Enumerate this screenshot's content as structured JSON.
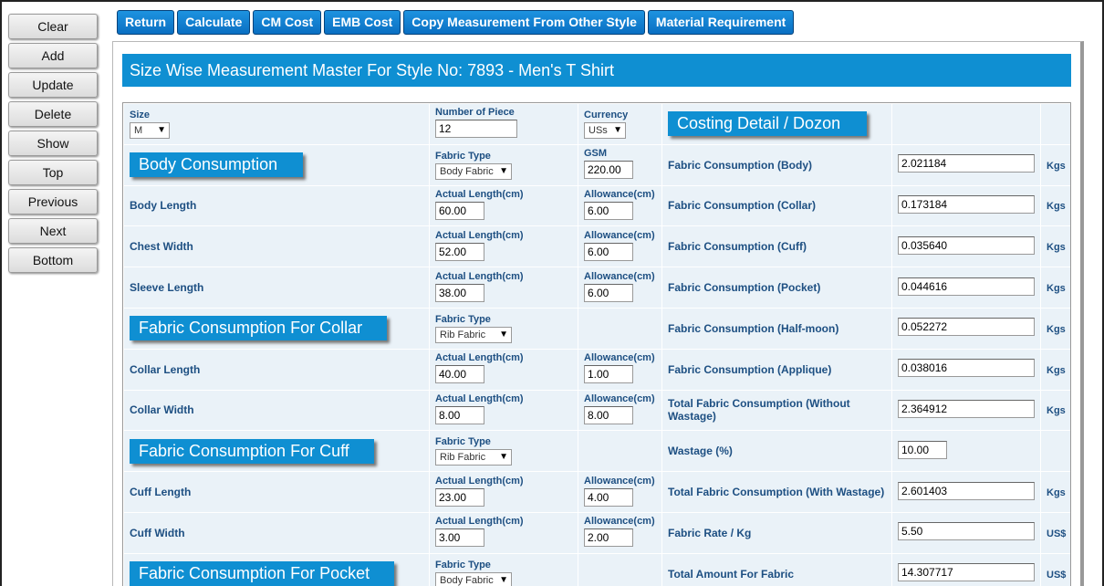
{
  "sidebar": [
    "Clear",
    "Add",
    "Update",
    "Delete",
    "Show",
    "Top",
    "Previous",
    "Next",
    "Bottom"
  ],
  "topbar": [
    "Return",
    "Calculate",
    "CM Cost",
    "EMB Cost",
    "Copy Measurement From Other Style",
    "Material Requirement"
  ],
  "title": "Size Wise Measurement Master For Style No: 7893 - Men's T Shirt",
  "header": {
    "size_label": "Size",
    "size_value": "M",
    "pieces_label": "Number of Piece",
    "pieces_value": "12",
    "currency_label": "Currency",
    "currency_value": "USs",
    "costing_title": "Costing Detail / Dozon"
  },
  "labels": {
    "fabric_type": "Fabric Type",
    "gsm": "GSM",
    "actual_length": "Actual Length(cm)",
    "allowance": "Allowance(cm)"
  },
  "rows": [
    {
      "section": "Body Consumption",
      "fabric_type": "Body Fabric",
      "gsm": "220.00",
      "cost_label": "Fabric Consumption (Body)",
      "cost_value": "2.021184",
      "unit": "Kgs"
    },
    {
      "label": "Body Length",
      "actual": "60.00",
      "allowance": "6.00",
      "cost_label": "Fabric Consumption (Collar)",
      "cost_value": "0.173184",
      "unit": "Kgs"
    },
    {
      "label": "Chest Width",
      "actual": "52.00",
      "allowance": "6.00",
      "cost_label": "Fabric Consumption (Cuff)",
      "cost_value": "0.035640",
      "unit": "Kgs"
    },
    {
      "label": "Sleeve Length",
      "actual": "38.00",
      "allowance": "6.00",
      "cost_label": "Fabric Consumption (Pocket)",
      "cost_value": "0.044616",
      "unit": "Kgs"
    },
    {
      "section": "Fabric Consumption For Collar",
      "fabric_type": "Rib Fabric",
      "cost_label": "Fabric Consumption (Half-moon)",
      "cost_value": "0.052272",
      "unit": "Kgs"
    },
    {
      "label": "Collar Length",
      "actual": "40.00",
      "allowance": "1.00",
      "cost_label": "Fabric Consumption (Applique)",
      "cost_value": "0.038016",
      "unit": "Kgs"
    },
    {
      "label": "Collar Width",
      "actual": "8.00",
      "allowance": "8.00",
      "cost_label": "Total Fabric Consumption (Without Wastage)",
      "cost_value": "2.364912",
      "unit": "Kgs"
    },
    {
      "section": "Fabric Consumption For Cuff",
      "fabric_type": "Rib Fabric",
      "cost_label": "Wastage (%)",
      "cost_value": "10.00",
      "unit": ""
    },
    {
      "label": "Cuff Length",
      "actual": "23.00",
      "allowance": "4.00",
      "cost_label": "Total Fabric Consumption (With Wastage)",
      "cost_value": "2.601403",
      "unit": "Kgs"
    },
    {
      "label": "Cuff Width",
      "actual": "3.00",
      "allowance": "2.00",
      "cost_label": "Fabric Rate / Kg",
      "cost_value": "5.50",
      "unit": "US$"
    },
    {
      "section": "Fabric Consumption For Pocket",
      "fabric_type": "Body Fabric",
      "cost_label": "Total Amount For Fabric",
      "cost_value": "14.307717",
      "unit": "US$"
    }
  ]
}
